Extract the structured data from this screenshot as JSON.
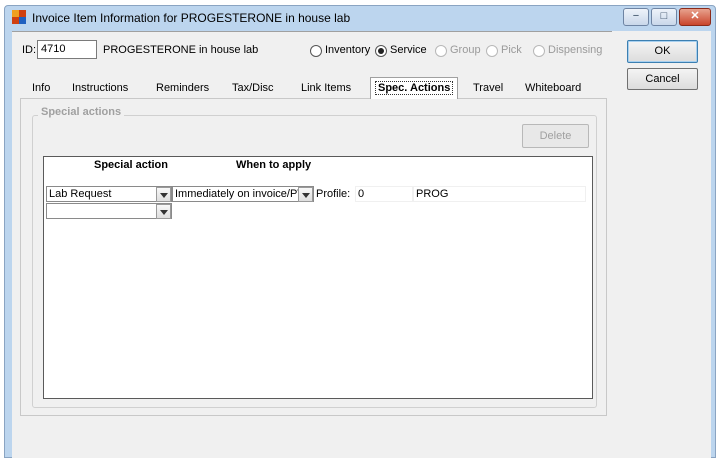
{
  "window": {
    "title": "Invoice Item Information for PROGESTERONE in house lab",
    "controls": {
      "minimize": "−",
      "maximize": "□",
      "close": "✕"
    }
  },
  "header": {
    "id_label": "ID:",
    "id_value": "4710",
    "item_name": "PROGESTERONE in house lab",
    "item_types": [
      {
        "label": "Inventory",
        "selected": false,
        "enabled": true
      },
      {
        "label": "Service",
        "selected": true,
        "enabled": true
      },
      {
        "label": "Group",
        "selected": false,
        "enabled": false
      },
      {
        "label": "Pick",
        "selected": false,
        "enabled": false
      },
      {
        "label": "Dispensing",
        "selected": false,
        "enabled": false
      }
    ]
  },
  "buttons": {
    "ok": "OK",
    "cancel": "Cancel",
    "delete": "Delete"
  },
  "tabs": [
    "Info",
    "Instructions",
    "Reminders",
    "Tax/Disc",
    "Link Items",
    "Spec. Actions",
    "Travel",
    "Whiteboard"
  ],
  "active_tab": "Spec. Actions",
  "special_actions": {
    "group_title": "Special actions",
    "columns": [
      "Special action",
      "When to apply"
    ],
    "rows": [
      {
        "action": "Lab Request",
        "when": "Immediately on invoice/PVL",
        "profile_label": "Profile:",
        "profile_value": "0",
        "code": "PROG"
      }
    ]
  }
}
